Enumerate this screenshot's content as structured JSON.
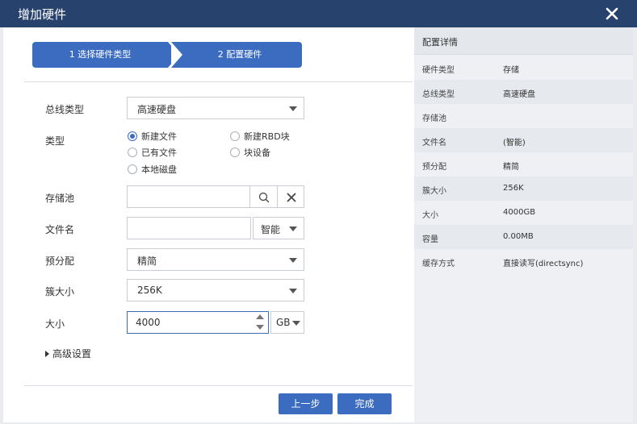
{
  "dialog": {
    "title": "增加硬件"
  },
  "stepper": {
    "step1": "1 选择硬件类型",
    "step2": "2 配置硬件"
  },
  "form": {
    "bus_type": {
      "label": "总线类型",
      "value": "高速硬盘"
    },
    "type": {
      "label": "类型",
      "options": [
        "新建文件",
        "新建RBD块",
        "已有文件",
        "块设备",
        "本地磁盘"
      ],
      "selected": "新建文件"
    },
    "storage_pool": {
      "label": "存储池",
      "value": ""
    },
    "file_name": {
      "label": "文件名",
      "value": "",
      "mode": "智能"
    },
    "prealloc": {
      "label": "预分配",
      "value": "精简"
    },
    "cluster_size": {
      "label": "簇大小",
      "value": "256K"
    },
    "size": {
      "label": "大小",
      "value": "4000",
      "unit": "GB"
    },
    "advanced": "高级设置"
  },
  "buttons": {
    "prev": "上一步",
    "finish": "完成"
  },
  "details": {
    "title": "配置详情",
    "rows": [
      {
        "key": "硬件类型",
        "value": "存储"
      },
      {
        "key": "总线类型",
        "value": "高速硬盘"
      },
      {
        "key": "存储池",
        "value": ""
      },
      {
        "key": "文件名",
        "value": "(智能)"
      },
      {
        "key": "预分配",
        "value": "精简"
      },
      {
        "key": "簇大小",
        "value": "256K"
      },
      {
        "key": "大小",
        "value": "4000GB"
      },
      {
        "key": "容量",
        "value": "0.00MB"
      },
      {
        "key": "缓存方式",
        "value": "直接读写(directsync)"
      }
    ]
  },
  "colors": {
    "titlebar": "#28426e",
    "accent": "#3b6cc0",
    "panel": "#eef0f3"
  }
}
